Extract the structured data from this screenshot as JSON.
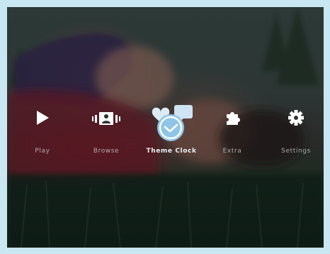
{
  "menu": {
    "items": [
      {
        "label": "Play",
        "icon": "play-icon"
      },
      {
        "label": "Browse",
        "icon": "browse-icon"
      },
      {
        "label": "Theme Clock",
        "icon": "theme-clock-icon",
        "active": true
      },
      {
        "label": "Extra",
        "icon": "extra-icon"
      },
      {
        "label": "Settings",
        "icon": "gear-icon"
      }
    ]
  },
  "colors": {
    "frame": "#c9e6f3",
    "icon": "#ffffff",
    "active_accent": "#8fc6e8"
  }
}
